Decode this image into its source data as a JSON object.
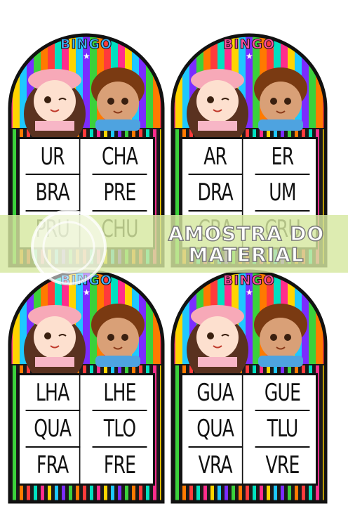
{
  "cards": [
    {
      "title": "BINGO",
      "cells": [
        "UR",
        "CHA",
        "BRA",
        "PRE",
        "PRU",
        "CHU"
      ]
    },
    {
      "title": "BINGO",
      "cells": [
        "AR",
        "ER",
        "DRA",
        "UM",
        "CRA",
        "CRU"
      ]
    },
    {
      "title": "BINGO",
      "cells": [
        "LHA",
        "LHE",
        "QUA",
        "TLO",
        "FRA",
        "FRE"
      ]
    },
    {
      "title": "BINGO",
      "cells": [
        "GUA",
        "GUE",
        "QUA",
        "TLU",
        "VRA",
        "VRE"
      ]
    }
  ],
  "watermark": {
    "line1": "AMOSTRA DO",
    "line2": "MATERIAL"
  },
  "colors": {
    "stripes": [
      "#ff2d8c",
      "#ffd400",
      "#1ec8ff",
      "#7b2cff",
      "#3bd13b",
      "#ff7a00",
      "#ff3b3b",
      "#00e0c0"
    ],
    "frame": "#111111",
    "title_fill": "#ff4fa0",
    "title_fill_alt": "#3fb4ff",
    "banner": "#d6e8a0"
  }
}
